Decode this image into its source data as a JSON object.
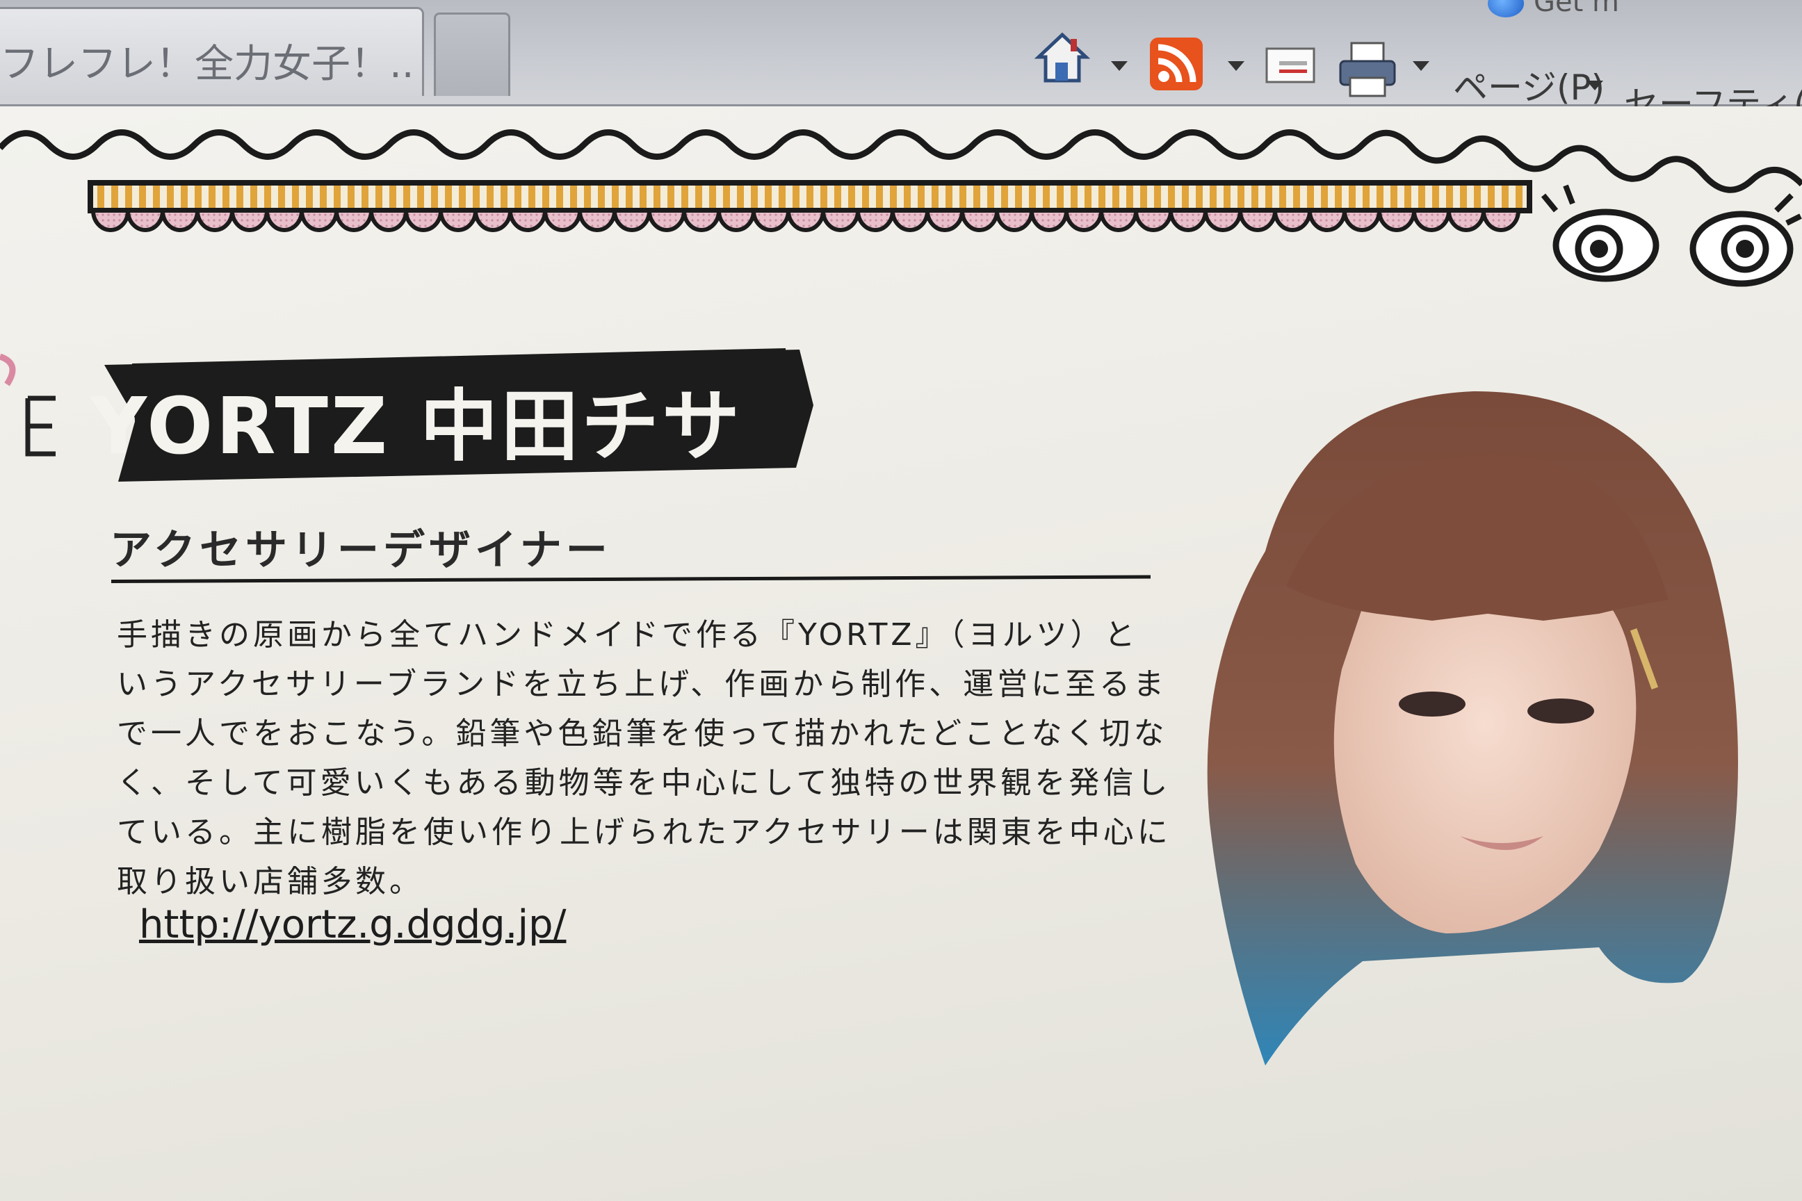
{
  "browser": {
    "tab_title": "フレフレ！全力女子！...",
    "get_more_label": "Get m",
    "page_menu": "ページ(P)",
    "safety_menu": "セーフティ(S)",
    "icons": [
      "home-icon",
      "rss-feed-icon",
      "mail-icon",
      "print-icon"
    ]
  },
  "profile": {
    "name": "YORTZ 中田チサ",
    "role": "アクセサリーデザイナー",
    "bio_lines": [
      "手描きの原画から全てハンドメイドで作る『YORTZ』（ヨルツ）と",
      "いうアクセサリーブランドを立ち上げ、作画から制作、運営に至るま",
      "で一人でをおこなう。鉛筆や色鉛筆を使って描かれたどことなく切な",
      "く、そして可愛いくもある動物等を中心にして独特の世界観を発信し",
      "ている。主に樹脂を使い作り上げられたアクセサリーは関東を中心に",
      "取り扱い店舗多数。"
    ],
    "link": "http://yortz.g.dgdg.jp/"
  },
  "colors": {
    "ribbon": "#1c1c1c",
    "awning_stripe": "#e0a43a",
    "scallop_pink": "#e6b8c6",
    "hair": "#7a4a3a",
    "hair_tips": "#2f86b8"
  }
}
